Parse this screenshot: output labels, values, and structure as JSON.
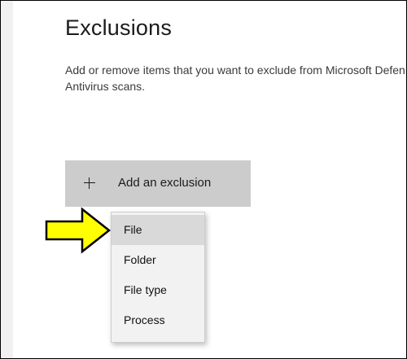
{
  "page": {
    "title": "Exclusions",
    "description_line1": "Add or remove items that you want to exclude from Microsoft Defender",
    "description_line2": "Antivirus scans."
  },
  "add_button": {
    "label": "Add an exclusion",
    "icon": "plus-icon"
  },
  "menu": {
    "items": [
      {
        "label": "File",
        "selected": true
      },
      {
        "label": "Folder",
        "selected": false
      },
      {
        "label": "File type",
        "selected": false
      },
      {
        "label": "Process",
        "selected": false
      }
    ]
  },
  "annotation": {
    "icon": "arrow-right-icon",
    "color": "#ffff00",
    "outline": "#000000"
  },
  "colors": {
    "button_bg": "#cccccc",
    "menu_bg": "#f2f2f2",
    "selected_item_bg": "#d9d9d9"
  }
}
